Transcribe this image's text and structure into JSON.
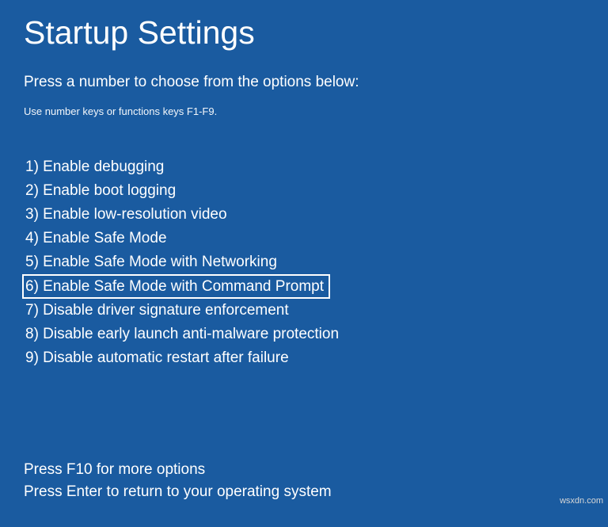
{
  "title": "Startup Settings",
  "subtitle": "Press a number to choose from the options below:",
  "instruction": "Use number keys or functions keys F1-F9.",
  "options": [
    {
      "num": "1",
      "label": "Enable debugging",
      "highlighted": false
    },
    {
      "num": "2",
      "label": "Enable boot logging",
      "highlighted": false
    },
    {
      "num": "3",
      "label": "Enable low-resolution video",
      "highlighted": false
    },
    {
      "num": "4",
      "label": "Enable Safe Mode",
      "highlighted": false
    },
    {
      "num": "5",
      "label": "Enable Safe Mode with Networking",
      "highlighted": false
    },
    {
      "num": "6",
      "label": "Enable Safe Mode with Command Prompt",
      "highlighted": true
    },
    {
      "num": "7",
      "label": "Disable driver signature enforcement",
      "highlighted": false
    },
    {
      "num": "8",
      "label": "Disable early launch anti-malware protection",
      "highlighted": false
    },
    {
      "num": "9",
      "label": "Disable automatic restart after failure",
      "highlighted": false
    }
  ],
  "footer": {
    "more": "Press F10 for more options",
    "return": "Press Enter to return to your operating system"
  },
  "watermark": "wsxdn.com"
}
